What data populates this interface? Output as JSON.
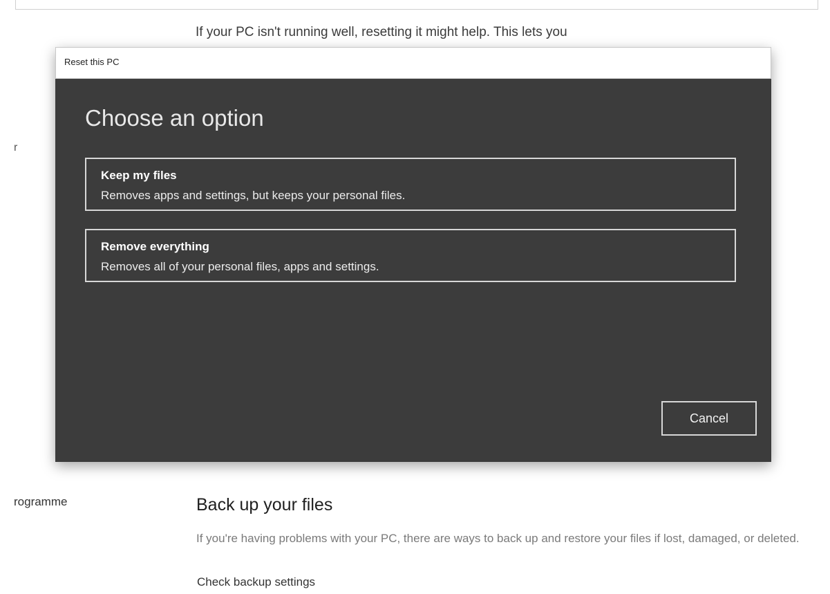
{
  "background": {
    "intro_text": "If your PC isn't running well, resetting it might help. This lets you",
    "side_fragment_r": "r",
    "side_fragment_programme": "rogramme",
    "section_title": "Back up your files",
    "section_desc": "If you're having problems with your PC, there are ways to back up and restore your files if lost, damaged, or deleted.",
    "section_link": "Check backup settings"
  },
  "dialog": {
    "window_title": "Reset this PC",
    "heading": "Choose an option",
    "options": [
      {
        "title": "Keep my files",
        "description": "Removes apps and settings, but keeps your personal files."
      },
      {
        "title": "Remove everything",
        "description": "Removes all of your personal files, apps and settings."
      }
    ],
    "cancel_label": "Cancel"
  },
  "colors": {
    "dialog_background": "#3c3c3c",
    "option_border": "#d8d8d8",
    "page_background": "#ffffff"
  }
}
